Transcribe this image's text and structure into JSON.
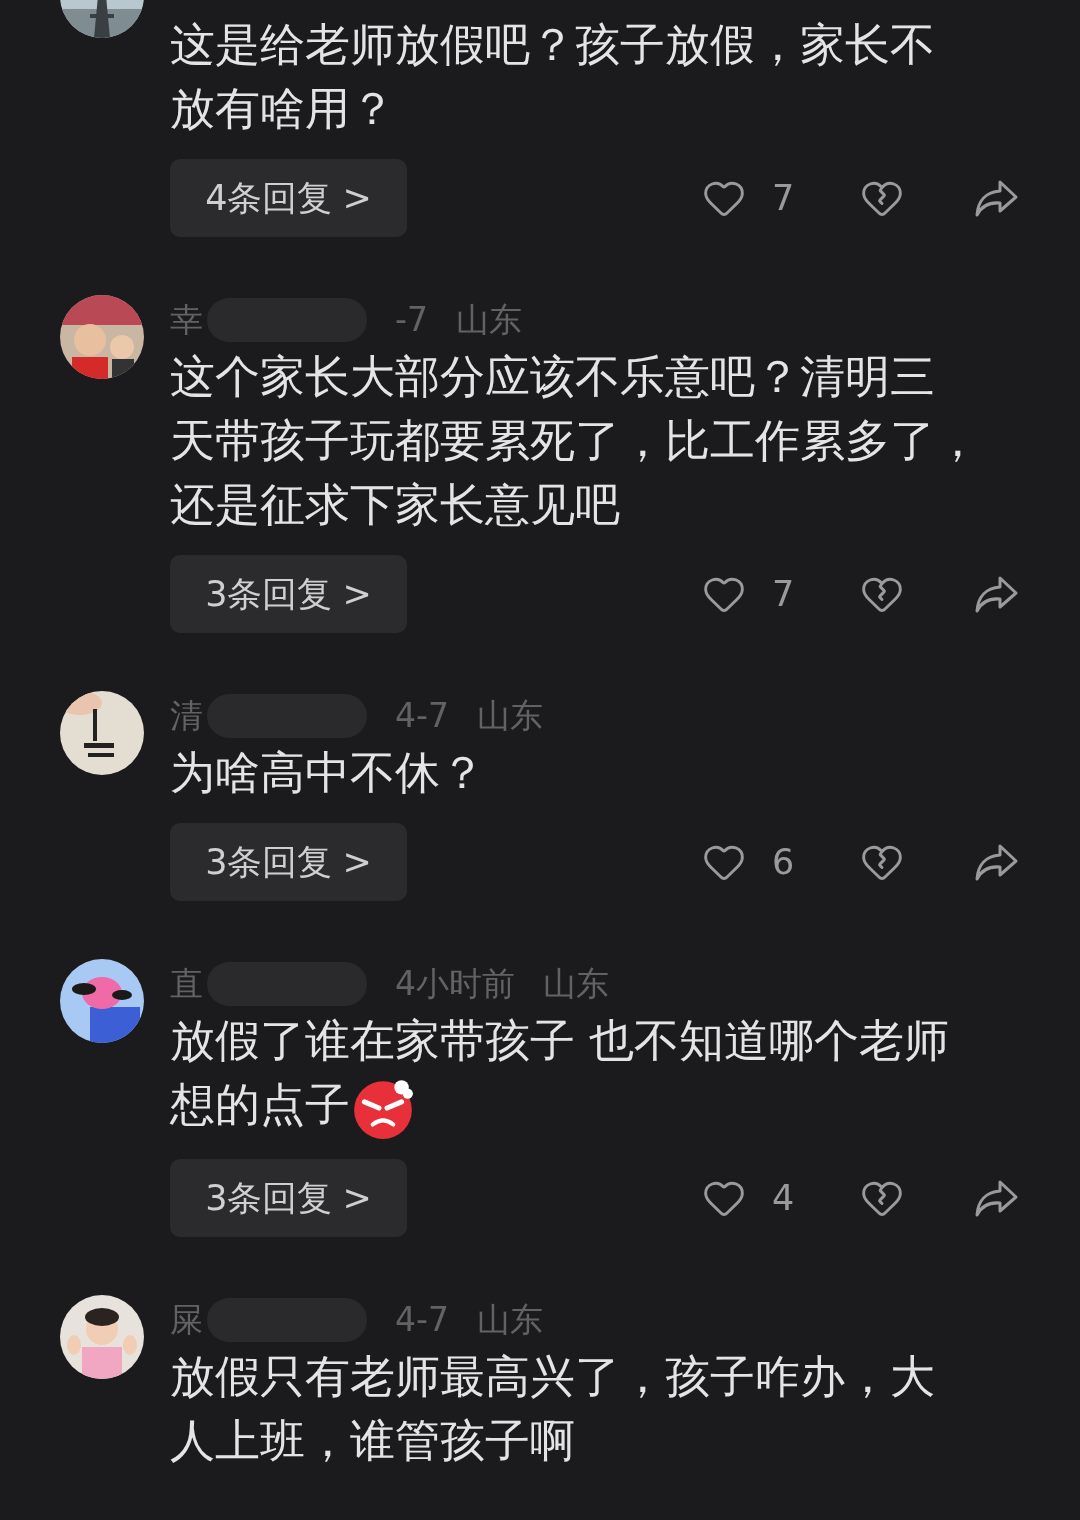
{
  "comments": [
    {
      "lines": [
        "这是给老师放假吧？孩子放假，家长不",
        "放有啥用？"
      ],
      "replies": "4条回复",
      "arrow": ">",
      "likes": "7"
    },
    {
      "author": "幸",
      "time": "-7",
      "location": "山东",
      "lines": [
        "这个家长大部分应该不乐意吧？清明三",
        "天带孩子玩都要累死了，比工作累多了，",
        "还是征求下家长意见吧"
      ],
      "replies": "3条回复",
      "arrow": ">",
      "likes": "7"
    },
    {
      "author": "清",
      "time": "4-7",
      "location": "山东",
      "lines": [
        "为啥高中不休？"
      ],
      "replies": "3条回复",
      "arrow": ">",
      "likes": "6"
    },
    {
      "author": "直",
      "time": "4小时前",
      "location": "山东",
      "lines": [
        "放假了谁在家带孩子 也不知道哪个老师",
        "想的点子"
      ],
      "emoji": {
        "kind": "angry"
      },
      "replies": "3条回复",
      "arrow": ">",
      "likes": "4"
    },
    {
      "author": "屎",
      "time": "4-7",
      "location": "山东",
      "lines": [
        "放假只有老师最高兴了，孩子咋办，大",
        "人上班，谁管孩子啊"
      ]
    }
  ]
}
